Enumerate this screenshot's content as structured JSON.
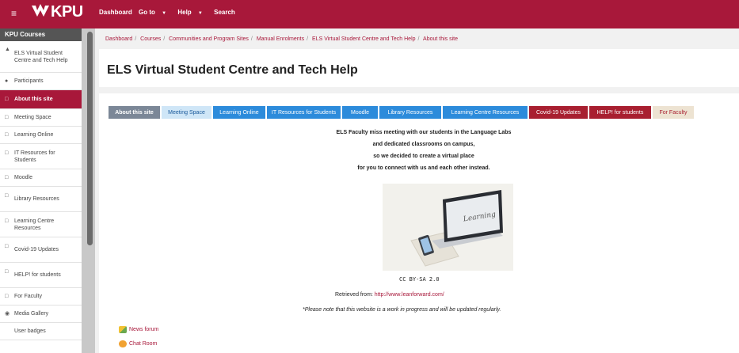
{
  "topbar": {
    "logo": "KPU",
    "nav": [
      "Dashboard",
      "Go to",
      "Help",
      "Search"
    ],
    "hamburger_icon": "menu-icon"
  },
  "sidebar": {
    "title": "KPU Courses",
    "items": [
      {
        "label": "ELS Virtual Student Centre and Tech Help",
        "icon": "mortarboard-icon"
      },
      {
        "label": "Participants",
        "icon": "users-icon"
      },
      {
        "label": "About this site",
        "icon": "folder-icon",
        "active": true
      },
      {
        "label": "Meeting Space",
        "icon": "folder-icon"
      },
      {
        "label": "Learning Online",
        "icon": "folder-icon"
      },
      {
        "label": "IT Resources for Students",
        "icon": "folder-icon"
      },
      {
        "label": "Moodle",
        "icon": "folder-icon"
      },
      {
        "label": "Library Resources",
        "icon": "folder-icon"
      },
      {
        "label": "Learning Centre Resources",
        "icon": "folder-icon"
      },
      {
        "label": "Covid-19 Updates",
        "icon": "folder-icon"
      },
      {
        "label": "HELP! for students",
        "icon": "folder-icon"
      },
      {
        "label": "For Faculty",
        "icon": "folder-icon"
      },
      {
        "label": "Media Gallery",
        "icon": "media-icon"
      },
      {
        "label": "User badges",
        "icon": ""
      }
    ]
  },
  "breadcrumb": [
    "Dashboard",
    "Courses",
    "Communities and Program Sites",
    "Manual Enrolments",
    "ELS Virtual Student Centre and Tech Help",
    "About this site"
  ],
  "page_title": "ELS Virtual Student Centre and Tech Help",
  "tabs": [
    {
      "label": "About this site"
    },
    {
      "label": "Meeting Space"
    },
    {
      "label": "Learning Online"
    },
    {
      "label": "IT Resources for Students"
    },
    {
      "label": "Moodle"
    },
    {
      "label": "Library Resources"
    },
    {
      "label": "Learning Centre Resources"
    },
    {
      "label": "Covid-19 Updates"
    },
    {
      "label": "HELP! for students"
    },
    {
      "label": "For Faculty"
    }
  ],
  "intro": [
    "ELS Faculty miss meeting with our students in the Language Labs",
    "and dedicated classrooms on campus,",
    "so we decided to create a virtual place",
    "for you to connect with us and each other instead."
  ],
  "image": {
    "screen_text": "Learning"
  },
  "license": "CC BY-SA 2.0",
  "retrieved_prefix": "Retrieved from: ",
  "retrieved_link": "http://www.leanforward.com/",
  "note": "*Please note that this website is a work in progress and will be updated regularly.",
  "activities": [
    {
      "label": "News forum",
      "icon": "forum-icon"
    },
    {
      "label": "Chat Room",
      "icon": "chat-icon"
    }
  ],
  "colors": {
    "brand": "#a8183a",
    "tab_blue": "#2c8bdb",
    "tab_grey": "#7b8797"
  }
}
